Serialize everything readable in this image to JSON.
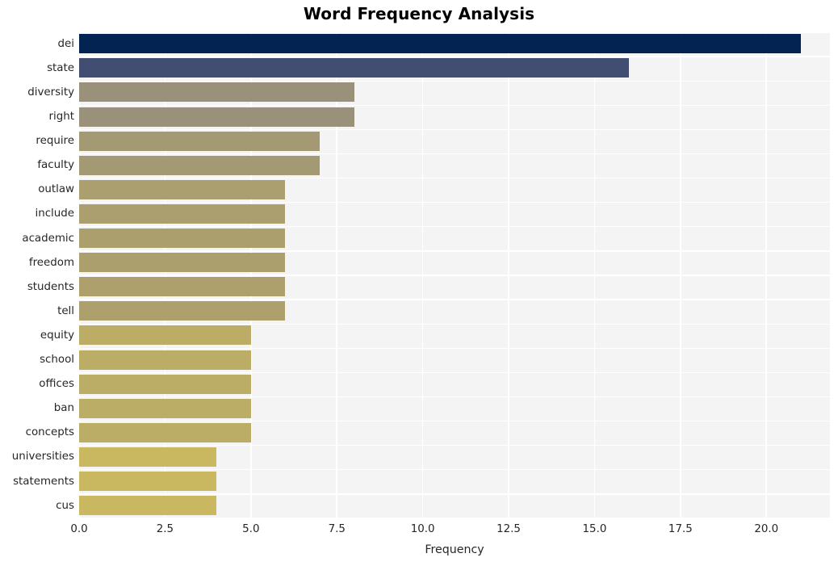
{
  "chart_data": {
    "type": "bar",
    "orientation": "horizontal",
    "title": "Word Frequency Analysis",
    "xlabel": "Frequency",
    "ylabel": "",
    "categories": [
      "dei",
      "state",
      "diversity",
      "right",
      "require",
      "faculty",
      "outlaw",
      "include",
      "academic",
      "freedom",
      "students",
      "tell",
      "equity",
      "school",
      "offices",
      "ban",
      "concepts",
      "universities",
      "statements",
      "cus"
    ],
    "values": [
      21,
      16,
      8,
      8,
      7,
      7,
      6,
      6,
      6,
      6,
      6,
      6,
      5,
      5,
      5,
      5,
      5,
      4,
      4,
      4
    ],
    "xlim": [
      0,
      21.85
    ],
    "ylim": [
      0,
      20
    ],
    "xticks": [
      0.0,
      2.5,
      5.0,
      7.5,
      10.0,
      12.5,
      15.0,
      17.5,
      20.0
    ],
    "xticklabels": [
      "0.0",
      "2.5",
      "5.0",
      "7.5",
      "10.0",
      "12.5",
      "15.0",
      "17.5",
      "20.0"
    ],
    "grid": true,
    "grid_color": "#ffffff",
    "legend": "none",
    "plot_background": "#f4f4f5",
    "figure_background": "#ffffff",
    "bar_colors": [
      "#032352",
      "#414e71",
      "#99917a",
      "#99917a",
      "#a39a74",
      "#a39a74",
      "#ab9f6f",
      "#ab9f6f",
      "#ac9f6e",
      "#ac9f6e",
      "#ada06d",
      "#ada06d",
      "#bcad66",
      "#bcad66",
      "#bcad66",
      "#bcad66",
      "#bcad66",
      "#c9b860",
      "#c9b860",
      "#c9b860"
    ]
  }
}
